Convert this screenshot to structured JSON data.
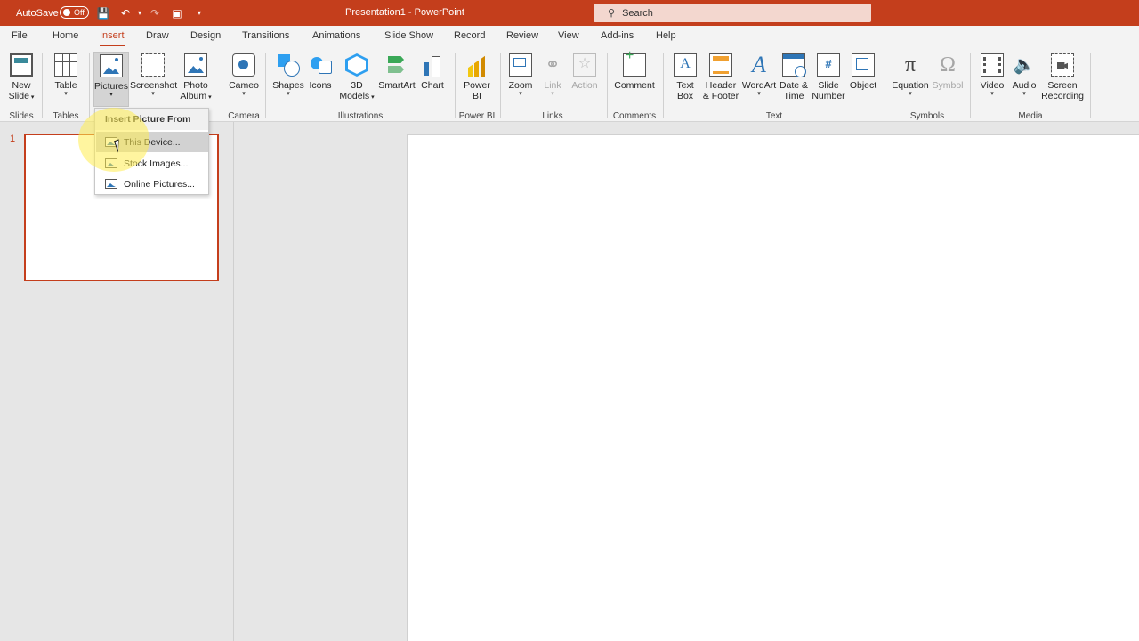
{
  "titlebar": {
    "autosave_label": "AutoSave",
    "autosave_state": "Off",
    "title": "Presentation1 - PowerPoint",
    "search_placeholder": "Search"
  },
  "tabs": [
    "File",
    "Home",
    "Insert",
    "Draw",
    "Design",
    "Transitions",
    "Animations",
    "Slide Show",
    "Record",
    "Review",
    "View",
    "Add-ins",
    "Help"
  ],
  "active_tab": "Insert",
  "ribbon": {
    "new_slide": [
      "New",
      "Slide"
    ],
    "table": "Table",
    "pictures": "Pictures",
    "screenshot": "Screenshot",
    "photo_album": [
      "Photo",
      "Album"
    ],
    "cameo": "Cameo",
    "shapes": "Shapes",
    "icons": "Icons",
    "models_3d": [
      "3D",
      "Models"
    ],
    "smartart": "SmartArt",
    "chart": "Chart",
    "power_bi": [
      "Power",
      "BI"
    ],
    "zoom": "Zoom",
    "link": "Link",
    "action": "Action",
    "comment": "Comment",
    "text_box": [
      "Text",
      "Box"
    ],
    "header_footer": [
      "Header",
      "& Footer"
    ],
    "wordart": "WordArt",
    "date_time": [
      "Date &",
      "Time"
    ],
    "slide_number": [
      "Slide",
      "Number"
    ],
    "object": "Object",
    "equation": "Equation",
    "symbol": "Symbol",
    "video": "Video",
    "audio": "Audio",
    "screen_recording": [
      "Screen",
      "Recording"
    ],
    "groups": {
      "slides": "Slides",
      "tables": "Tables",
      "camera": "Camera",
      "illustrations": "Illustrations",
      "power_bi": "Power BI",
      "links": "Links",
      "comments": "Comments",
      "text": "Text",
      "symbols": "Symbols",
      "media": "Media"
    }
  },
  "dropdown": {
    "header": "Insert Picture From",
    "items": [
      "This Device...",
      "Stock Images...",
      "Online Pictures..."
    ],
    "hovered": "This Device..."
  },
  "slides_pane": {
    "slide_number": "1"
  },
  "colors": {
    "accent": "#c43e1c",
    "ribbon_bg": "#f3f3f3",
    "pane_bg": "#e6e6e6"
  }
}
